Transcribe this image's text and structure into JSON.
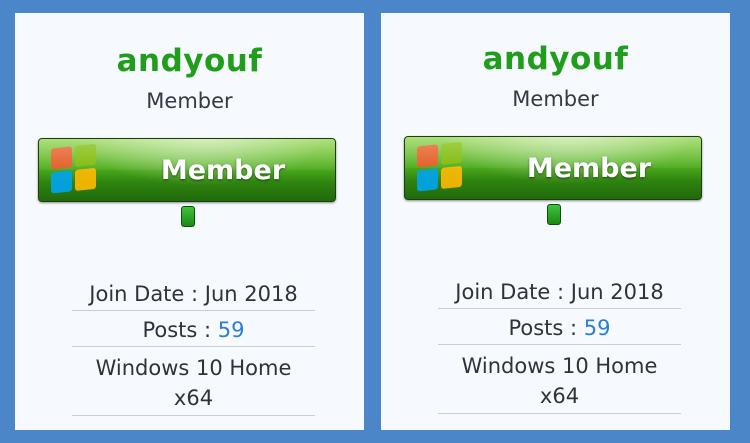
{
  "panels": [
    {
      "username": "andyouf",
      "user_title": "Member",
      "rank_label": "Member",
      "join_date": "Join Date : Jun 2018",
      "posts_label": "Posts : ",
      "posts_value": "59",
      "os_line1": "Windows 10 Home",
      "os_line2": "x64"
    },
    {
      "username": "andyouf",
      "user_title": "Member",
      "rank_label": "Member",
      "join_date": "Join Date : Jun 2018",
      "posts_label": "Posts : ",
      "posts_value": "59",
      "os_line1": "Windows 10 Home",
      "os_line2": "x64"
    }
  ],
  "colors": {
    "background": "#4a86c8",
    "panel": "#f6f9fd",
    "username": "#1f9d1b",
    "link": "#2a7fd4"
  },
  "icons": {
    "rank_logo": "windows-logo-icon",
    "reputation": "reputation-pip-icon"
  }
}
